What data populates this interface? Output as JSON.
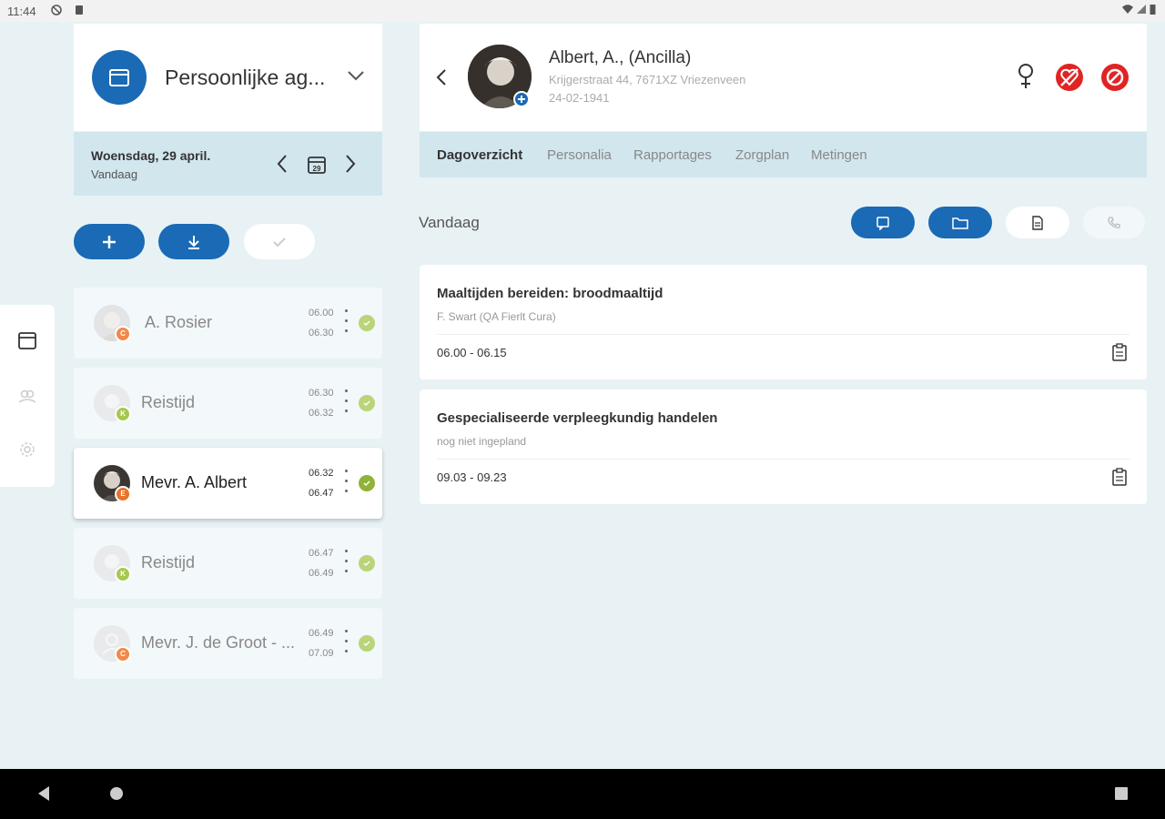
{
  "status_bar": {
    "time": "11:44"
  },
  "agenda": {
    "title": "Persoonlijke ag...",
    "date": "Woensdag, 29 april.",
    "date_sub": "Vandaag",
    "calendar_badge": "29"
  },
  "appointments": [
    {
      "name": "A. Rosier",
      "start": "06.00",
      "end": "06.30",
      "badge": "C",
      "badge_color": "#f0894a"
    },
    {
      "name": "Reistijd",
      "start": "06.30",
      "end": "06.32",
      "badge": "K",
      "badge_color": "#a6c84f"
    },
    {
      "name": "Mevr. A. Albert",
      "start": "06.32",
      "end": "06.47",
      "badge": "E",
      "badge_color": "#e8732a"
    },
    {
      "name": "Reistijd",
      "start": "06.47",
      "end": "06.49",
      "badge": "K",
      "badge_color": "#a6c84f"
    },
    {
      "name": "Mevr. J. de Groot - ...",
      "start": "06.49",
      "end": "07.09",
      "badge": "C",
      "badge_color": "#f0894a"
    }
  ],
  "client": {
    "name": "Albert, A., (Ancilla)",
    "address": "Krijgerstraat 44, 7671XZ Vriezenveen",
    "dob": "24-02-1941"
  },
  "tabs": [
    "Dagoverzicht",
    "Personalia",
    "Rapportages",
    "Zorgplan",
    "Metingen"
  ],
  "today_label": "Vandaag",
  "tasks": [
    {
      "title": "Maaltijden bereiden: broodmaaltijd",
      "subtitle": "F. Swart (QA Fierlt Cura)",
      "time": "06.00 - 06.15"
    },
    {
      "title": "Gespecialiseerde verpleegkundig handelen",
      "subtitle": "nog niet ingepland",
      "time": "09.03 - 09.23"
    }
  ],
  "colors": {
    "primary": "#1a6ab5",
    "alert": "#e02424",
    "check": "#a6c84f"
  }
}
